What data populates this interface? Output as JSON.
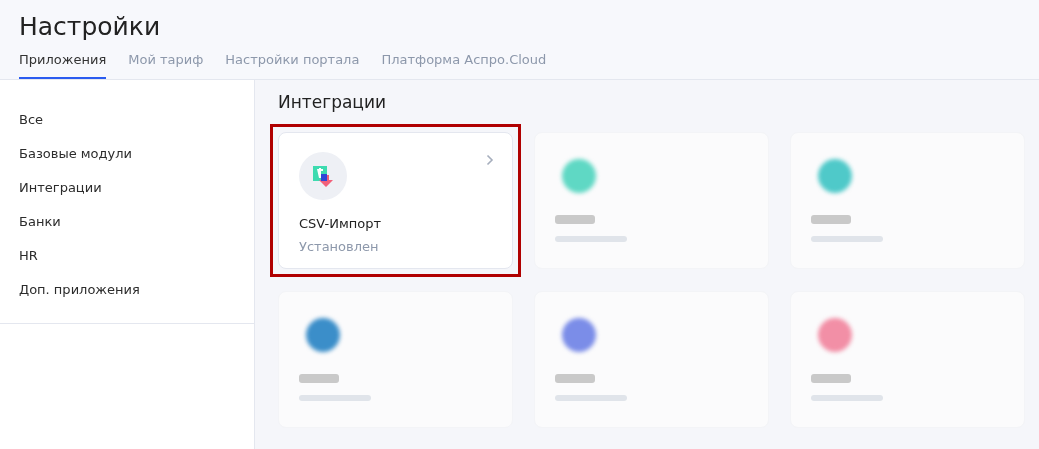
{
  "page": {
    "title": "Настройки"
  },
  "tabs": [
    {
      "label": "Приложения",
      "selected": true
    },
    {
      "label": "Мой тариф",
      "selected": false
    },
    {
      "label": "Настройки портала",
      "selected": false
    },
    {
      "label": "Платформа Аспро.Cloud",
      "selected": false
    }
  ],
  "sidebar": {
    "items": [
      {
        "label": "Все"
      },
      {
        "label": "Базовые модули"
      },
      {
        "label": "Интеграции"
      },
      {
        "label": "Банки"
      },
      {
        "label": "HR"
      },
      {
        "label": "Доп. приложения"
      }
    ]
  },
  "section": {
    "title": "Интеграции"
  },
  "cards": [
    {
      "kind": "app",
      "name": "CSV-Импорт",
      "status": "Установлен",
      "highlighted": true
    },
    {
      "kind": "blurred",
      "color": "#5fd8c4",
      "highlighted": false
    },
    {
      "kind": "blurred",
      "color": "#4fc9c9",
      "highlighted": false
    },
    {
      "kind": "blurred",
      "color": "#3b8ec9",
      "highlighted": false
    },
    {
      "kind": "blurred",
      "color": "#7b8de8",
      "highlighted": false
    },
    {
      "kind": "blurred",
      "color": "#f28fa6",
      "highlighted": false
    }
  ]
}
